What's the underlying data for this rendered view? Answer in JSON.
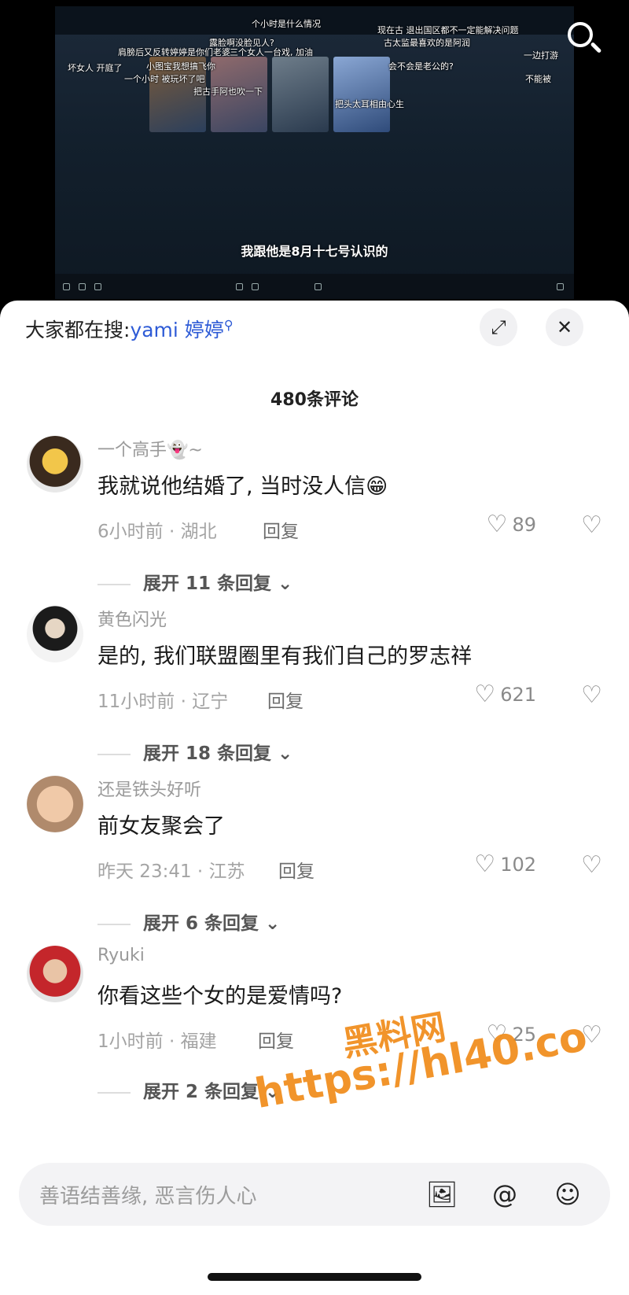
{
  "video": {
    "subtitle": "我跟他是8月十七号认识的",
    "danmaku": [
      "个小时是什么情况",
      "现在古 退出国区都不一定能解决问题",
      "露脸啊没脸见人?",
      "肩膀后又反转",
      "婷婷是你们老婆",
      "三个女人一台戏, 加油",
      "古太监最喜欢的是阿润",
      "坏女人 开庭了",
      "小图宝我想搞飞你",
      "一个小时 被玩坏了吧",
      "一边打游",
      "把古手阿也吹一下",
      "会不会是老公的?",
      "把头太耳相由心生",
      "不能被"
    ]
  },
  "sheet": {
    "search_prefix": "大家都在搜:",
    "search_keyword": "yami 婷婷",
    "comment_count": "480条评论"
  },
  "comments": [
    {
      "user": "一个高手👻~",
      "text": "我就说他结婚了, 当时没人信😁",
      "meta": "6小时前 · 湖北",
      "reply": "回复",
      "likes": "89",
      "expand": "展开 11 条回复"
    },
    {
      "user": "黄色闪光",
      "text": "是的, 我们联盟圈里有我们自己的罗志祥",
      "meta": "11小时前 · 辽宁",
      "reply": "回复",
      "likes": "621",
      "expand": "展开 18 条回复"
    },
    {
      "user": "还是铁头好听",
      "text": "前女友聚会了",
      "meta": "昨天 23:41 · 江苏",
      "reply": "回复",
      "likes": "102",
      "expand": "展开 6 条回复"
    },
    {
      "user": "Ryuki",
      "text": "你看这些个女的是爱情吗?",
      "meta": "1小时前 · 福建",
      "reply": "回复",
      "likes": "25",
      "expand": "展开 2 条回复"
    }
  ],
  "composer": {
    "placeholder": "善语结善缘, 恶言伤人心"
  },
  "watermark": {
    "line1": "黑料网",
    "line2": "https://hl40.co"
  },
  "colors": {
    "keyword": "#2e5bd6",
    "watermark": "#f08c1a"
  }
}
